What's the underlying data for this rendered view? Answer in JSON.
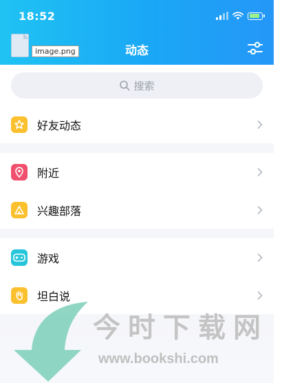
{
  "status_bar": {
    "time": "18:52"
  },
  "header": {
    "title": "动态",
    "broken_image_label": "image.png"
  },
  "search": {
    "placeholder": "搜索"
  },
  "groups": [
    {
      "items": [
        {
          "label": "好友动态",
          "icon": "star-icon",
          "color": "#fbc02d"
        }
      ]
    },
    {
      "items": [
        {
          "label": "附近",
          "icon": "location-pin-icon",
          "color": "#f0506e"
        },
        {
          "label": "兴趣部落",
          "icon": "tent-icon",
          "color": "#fbc02d"
        }
      ]
    },
    {
      "items": [
        {
          "label": "游戏",
          "icon": "gamepad-icon",
          "color": "#26c6da"
        },
        {
          "label": "坦白说",
          "icon": "hand-icon",
          "color": "#fbc02d"
        }
      ]
    }
  ],
  "watermark": {
    "title": "今时下载网",
    "url": "www.bookshi.com"
  },
  "colors": {
    "header_gradient_start": "#1fc3f3",
    "header_gradient_end": "#2597f7",
    "page_background": "#f5f6fa"
  }
}
